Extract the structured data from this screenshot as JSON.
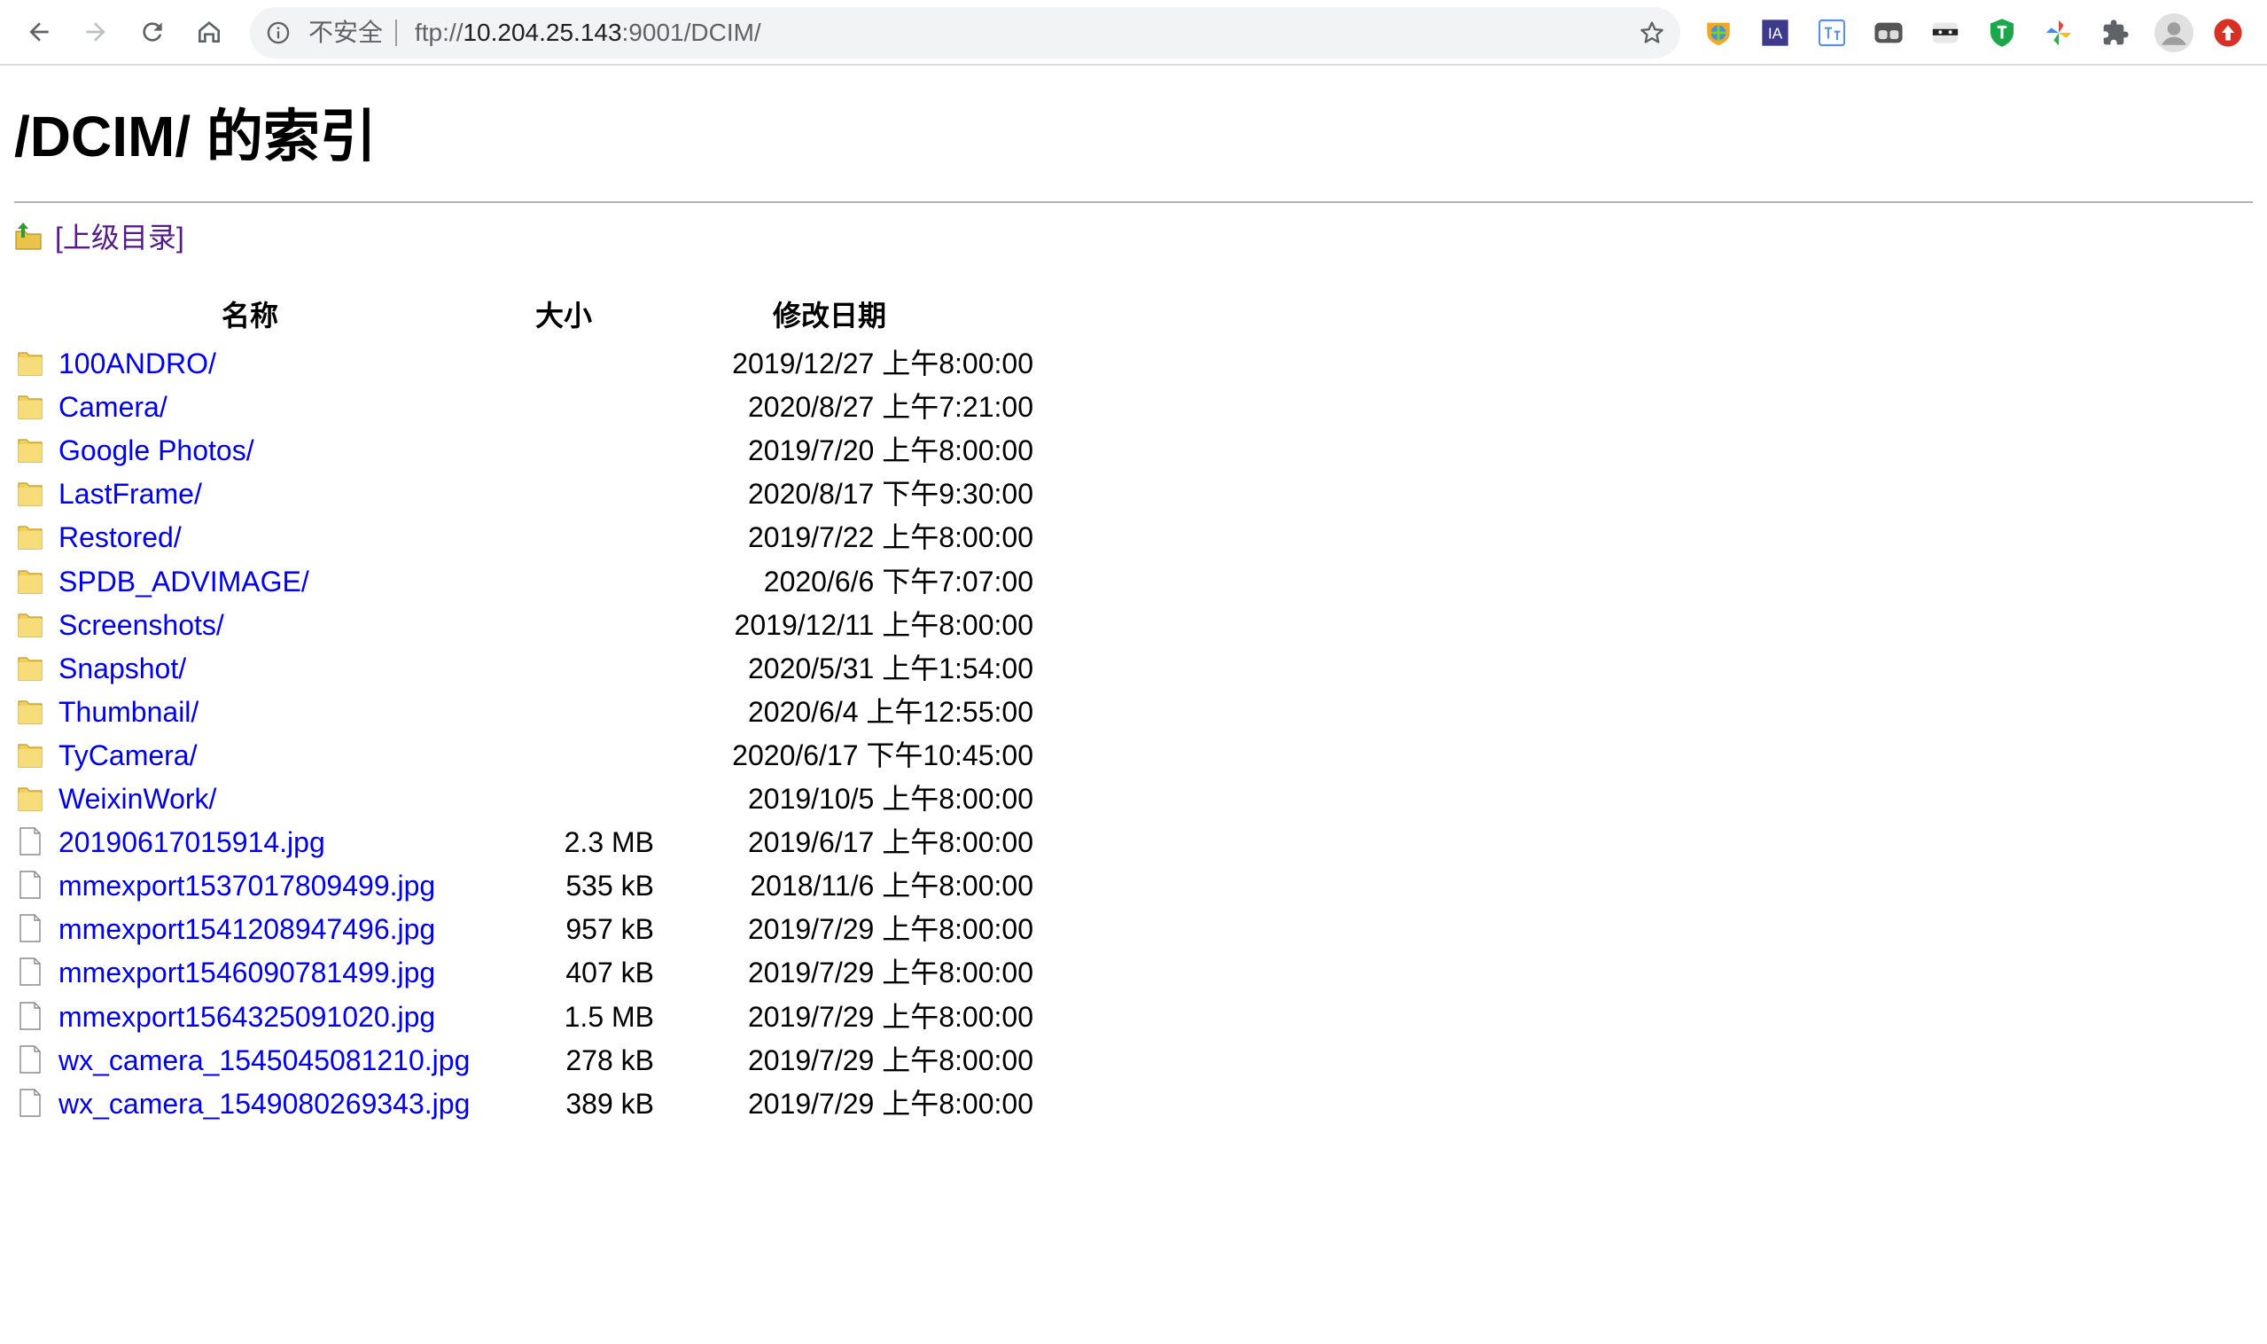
{
  "browser": {
    "security_label": "不安全",
    "url_scheme": "ftp://",
    "url_host": "10.204.25.143",
    "url_path": ":9001/DCIM/",
    "extensions": [
      "shield-globe-extension",
      "ia-extension",
      "translate-extension",
      "reader-extension",
      "incognito-mask-extension",
      "green-shield-extension",
      "pinwheel-extension",
      "puzzle-extensions-icon",
      "profile-avatar",
      "red-update-icon"
    ]
  },
  "page": {
    "title": "/DCIM/ 的索引",
    "parent_link": "[上级目录]",
    "columns": {
      "name": "名称",
      "size": "大小",
      "modified": "修改日期"
    }
  },
  "entries": [
    {
      "type": "folder",
      "name": "100ANDRO/",
      "size": "",
      "modified": "2019/12/27 上午8:00:00"
    },
    {
      "type": "folder",
      "name": "Camera/",
      "size": "",
      "modified": "2020/8/27 上午7:21:00"
    },
    {
      "type": "folder",
      "name": "Google Photos/",
      "size": "",
      "modified": "2019/7/20 上午8:00:00"
    },
    {
      "type": "folder",
      "name": "LastFrame/",
      "size": "",
      "modified": "2020/8/17 下午9:30:00"
    },
    {
      "type": "folder",
      "name": "Restored/",
      "size": "",
      "modified": "2019/7/22 上午8:00:00"
    },
    {
      "type": "folder",
      "name": "SPDB_ADVIMAGE/",
      "size": "",
      "modified": "2020/6/6 下午7:07:00"
    },
    {
      "type": "folder",
      "name": "Screenshots/",
      "size": "",
      "modified": "2019/12/11 上午8:00:00"
    },
    {
      "type": "folder",
      "name": "Snapshot/",
      "size": "",
      "modified": "2020/5/31 上午1:54:00"
    },
    {
      "type": "folder",
      "name": "Thumbnail/",
      "size": "",
      "modified": "2020/6/4 上午12:55:00"
    },
    {
      "type": "folder",
      "name": "TyCamera/",
      "size": "",
      "modified": "2020/6/17 下午10:45:00"
    },
    {
      "type": "folder",
      "name": "WeixinWork/",
      "size": "",
      "modified": "2019/10/5 上午8:00:00"
    },
    {
      "type": "file",
      "name": "20190617015914.jpg",
      "size": "2.3 MB",
      "modified": "2019/6/17 上午8:00:00"
    },
    {
      "type": "file",
      "name": "mmexport1537017809499.jpg",
      "size": "535 kB",
      "modified": "2018/11/6 上午8:00:00"
    },
    {
      "type": "file",
      "name": "mmexport1541208947496.jpg",
      "size": "957 kB",
      "modified": "2019/7/29 上午8:00:00"
    },
    {
      "type": "file",
      "name": "mmexport1546090781499.jpg",
      "size": "407 kB",
      "modified": "2019/7/29 上午8:00:00"
    },
    {
      "type": "file",
      "name": "mmexport1564325091020.jpg",
      "size": "1.5 MB",
      "modified": "2019/7/29 上午8:00:00"
    },
    {
      "type": "file",
      "name": "wx_camera_1545045081210.jpg",
      "size": "278 kB",
      "modified": "2019/7/29 上午8:00:00"
    },
    {
      "type": "file",
      "name": "wx_camera_1549080269343.jpg",
      "size": "389 kB",
      "modified": "2019/7/29 上午8:00:00"
    }
  ],
  "colors": {
    "link": "#0000ee",
    "visited_link": "#551a8b",
    "omnibox_bg": "#f1f3f4"
  }
}
